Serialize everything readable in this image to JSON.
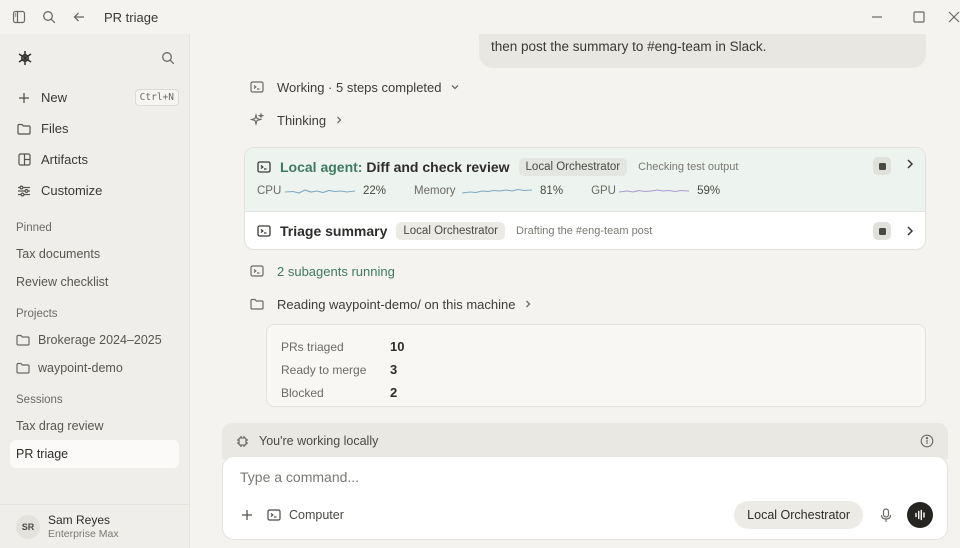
{
  "window": {
    "title": "PR triage"
  },
  "sidebar": {
    "nav": [
      {
        "label": "New",
        "shortcut": "Ctrl+N",
        "icon": "plus-icon"
      },
      {
        "label": "Files",
        "icon": "folder-icon"
      },
      {
        "label": "Artifacts",
        "icon": "artifacts-icon"
      },
      {
        "label": "Customize",
        "icon": "sliders-icon"
      }
    ],
    "pinned_header": "Pinned",
    "pinned": [
      "Tax documents",
      "Review checklist"
    ],
    "projects_header": "Projects",
    "projects": [
      "Brokerage 2024–2025",
      "waypoint-demo"
    ],
    "sessions_header": "Sessions",
    "sessions": [
      "Tax drag review",
      "PR triage"
    ],
    "user": {
      "initials": "SR",
      "name": "Sam Reyes",
      "plan": "Enterprise Max"
    }
  },
  "conversation": {
    "user_message_tail": "then post the summary to #eng-team in Slack.",
    "working_label": "Working · 5 steps completed",
    "thinking_label": "Thinking",
    "agents": [
      {
        "prefix": "Local agent:",
        "title": "Diff and check review",
        "chip": "Local Orchestrator",
        "status": "Checking test output",
        "metrics": [
          {
            "label": "CPU",
            "value": "22%"
          },
          {
            "label": "Memory",
            "value": "81%"
          },
          {
            "label": "GPU",
            "value": "59%"
          }
        ]
      },
      {
        "title": "Triage summary",
        "chip": "Local Orchestrator",
        "status": "Drafting the #eng-team post"
      }
    ],
    "subagents_label": "2 subagents running",
    "reading_label": "Reading waypoint-demo/ on this machine",
    "results": [
      {
        "label": "PRs triaged",
        "value": "10"
      },
      {
        "label": "Ready to merge",
        "value": "3"
      },
      {
        "label": "Blocked",
        "value": "2"
      }
    ]
  },
  "composer": {
    "banner": "You're working locally",
    "placeholder": "Type a command...",
    "target": "Computer",
    "model": "Local Orchestrator"
  },
  "colors": {
    "accent_green": "#3e7a62",
    "sparkline": "#7fa9c4",
    "gpu_sparkline": "#a69bd6"
  }
}
